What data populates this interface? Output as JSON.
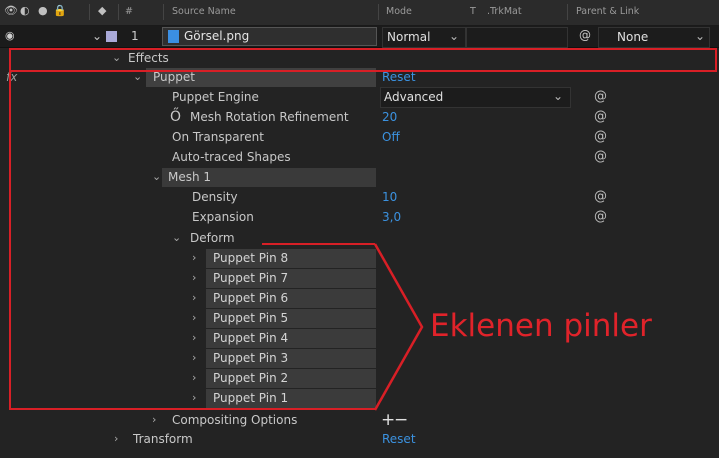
{
  "header": {
    "source_name": "Source Name",
    "mode": "Mode",
    "t": "T",
    "trkmat": ".TrkMat",
    "parent_link": "Parent & Link",
    "hash": "#"
  },
  "layer": {
    "number": "1",
    "name": "Görsel.png",
    "mode": "Normal",
    "parent": "None"
  },
  "effects": {
    "group_label": "Effects",
    "fx_badge": "fx",
    "puppet_label": "Puppet",
    "puppet_reset": "Reset",
    "props": [
      {
        "label": "Puppet Engine",
        "value": "Advanced"
      },
      {
        "label": "Mesh Rotation Refinement",
        "value": "20"
      },
      {
        "label": "On Transparent",
        "value": "Off"
      },
      {
        "label": "Auto-traced Shapes",
        "value": ""
      }
    ],
    "mesh_label": "Mesh 1",
    "density_label": "Density",
    "density_value": "10",
    "expansion_label": "Expansion",
    "expansion_value": "3,0",
    "deform_label": "Deform",
    "pins": [
      "Puppet Pin 8",
      "Puppet Pin 7",
      "Puppet Pin 6",
      "Puppet Pin 5",
      "Puppet Pin 4",
      "Puppet Pin 3",
      "Puppet Pin 2",
      "Puppet Pin 1"
    ],
    "compositing_label": "Compositing Options",
    "compositing_add": "+",
    "compositing_remove": "−"
  },
  "transform": {
    "label": "Transform",
    "reset": "Reset"
  },
  "annotation": {
    "text": "Eklenen pinler",
    "color": "#d81f26"
  },
  "icons": [
    "eye-icon",
    "speaker-icon",
    "solo-icon",
    "lock-icon",
    "label-icon",
    "chevron-icon",
    "spiral-icon",
    "stopwatch-icon",
    "file-icon"
  ],
  "colors": {
    "value_blue": "#3b92e0",
    "background": "#232323",
    "annotation_red": "#d81f26"
  }
}
